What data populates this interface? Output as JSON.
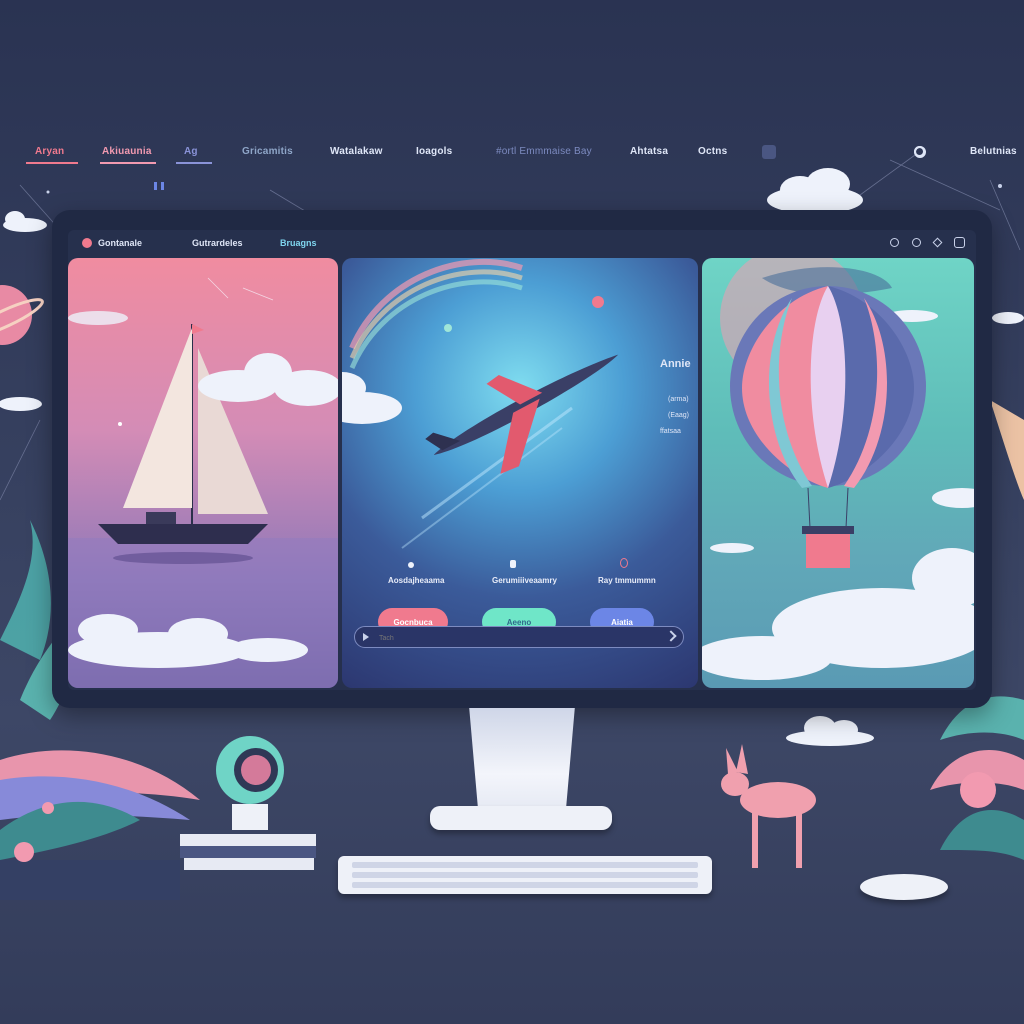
{
  "colors": {
    "background": "#2f3856",
    "accent_pink": "#f07a8e",
    "accent_mint": "#6fe6c8",
    "accent_blue": "#6c86e6"
  },
  "topnav": {
    "items": [
      {
        "label": "Aryan"
      },
      {
        "label": "Akiuaunia"
      },
      {
        "label": "Ag"
      },
      {
        "label": "Gricamitis"
      },
      {
        "label": "Watalakaw"
      },
      {
        "label": "Ioagols"
      },
      {
        "label": "#ortl Emmmaise Bay"
      },
      {
        "label": "Ahtatsa"
      },
      {
        "label": "Octns"
      },
      {
        "label": "Belutnias"
      }
    ],
    "icons": [
      "square-icon",
      "search-ring-icon",
      "sidebar-toggle-icon"
    ]
  },
  "app": {
    "tabs": [
      {
        "label": "Gontanale"
      },
      {
        "label": "Gutrardeles"
      },
      {
        "label": "Bruagns"
      }
    ],
    "window_controls": [
      "minimize-icon",
      "settings-icon",
      "diamond-icon",
      "square-icon"
    ]
  },
  "panels": {
    "middle": {
      "captions": [
        {
          "label": "Aosdajheaama"
        },
        {
          "label": "Gerumiiiveaamry"
        },
        {
          "label": "Ray tmmummn"
        }
      ],
      "buttons": [
        {
          "label": "Gocnbuca"
        },
        {
          "label": "Aeeno"
        },
        {
          "label": "Aiatia"
        }
      ],
      "search": {
        "placeholder": "Tach",
        "value": ""
      }
    },
    "side_info": {
      "title": "Annie",
      "lines": [
        "(arma)",
        "(Eaag)",
        "ffatsaa"
      ]
    }
  }
}
